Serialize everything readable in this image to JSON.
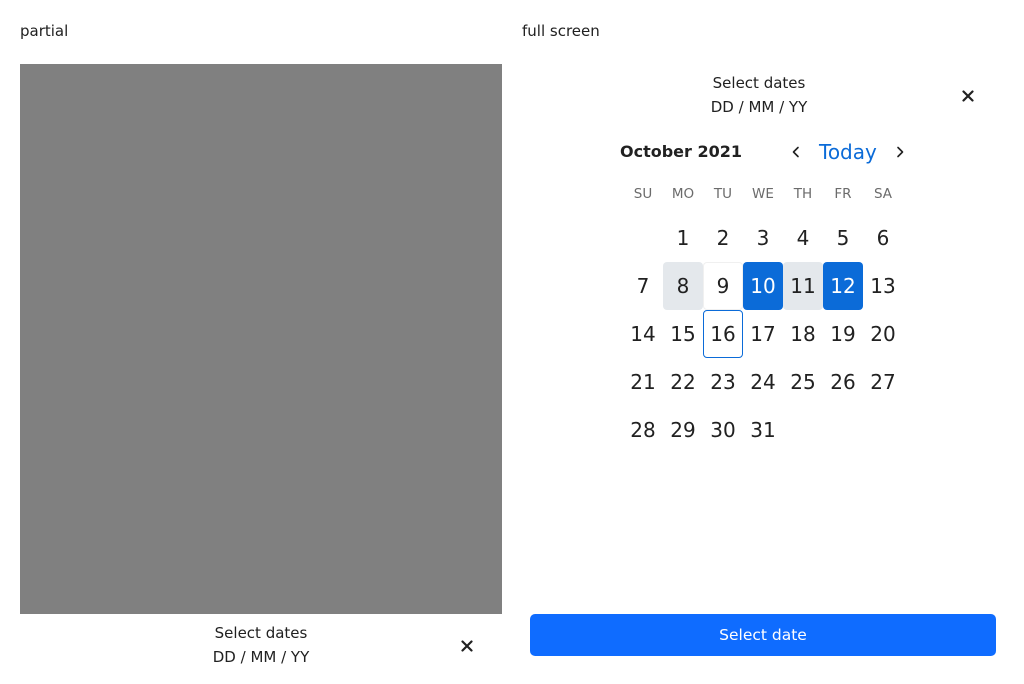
{
  "captions": {
    "partial": "partial",
    "full": "full screen"
  },
  "partial": {
    "header": {
      "title": "Select dates",
      "subtitle": "DD / MM / YY"
    }
  },
  "full": {
    "header": {
      "title": "Select dates",
      "subtitle": "DD / MM / YY"
    },
    "calendar": {
      "month_label": "October 2021",
      "today_label": "Today",
      "weekdays": [
        "SU",
        "MO",
        "TU",
        "WE",
        "TH",
        "FR",
        "SA"
      ],
      "first_weekday_index": 1,
      "days_in_month": 31,
      "selected_days": [
        10,
        12
      ],
      "in_range_days": [
        8,
        11
      ],
      "today_day": 16,
      "focused_day": 9
    },
    "primary_button": "Select date"
  },
  "colors": {
    "accent": "#0b6bd8",
    "button": "#0f6cff",
    "overlay": "#808080",
    "range": "#e4e8ec"
  },
  "icons": {
    "close": "close-icon",
    "prev": "chevron-left-icon",
    "next": "chevron-right-icon"
  }
}
